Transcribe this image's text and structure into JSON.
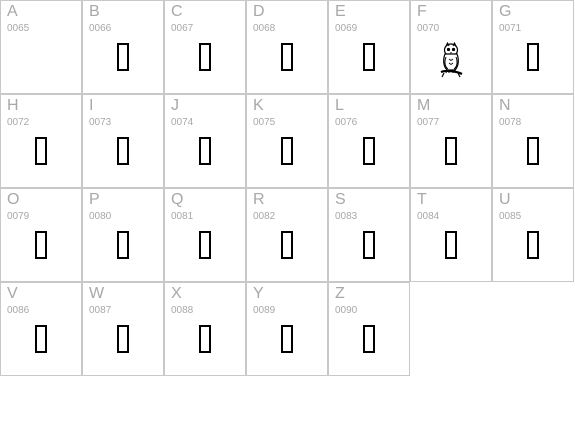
{
  "cells": [
    {
      "letter": "A",
      "code": "0065",
      "glyph": "empty"
    },
    {
      "letter": "B",
      "code": "0066",
      "glyph": "box"
    },
    {
      "letter": "C",
      "code": "0067",
      "glyph": "box"
    },
    {
      "letter": "D",
      "code": "0068",
      "glyph": "box"
    },
    {
      "letter": "E",
      "code": "0069",
      "glyph": "box"
    },
    {
      "letter": "F",
      "code": "0070",
      "glyph": "owl-icon"
    },
    {
      "letter": "G",
      "code": "0071",
      "glyph": "box"
    },
    {
      "letter": "H",
      "code": "0072",
      "glyph": "box"
    },
    {
      "letter": "I",
      "code": "0073",
      "glyph": "box"
    },
    {
      "letter": "J",
      "code": "0074",
      "glyph": "box"
    },
    {
      "letter": "K",
      "code": "0075",
      "glyph": "box"
    },
    {
      "letter": "L",
      "code": "0076",
      "glyph": "box"
    },
    {
      "letter": "M",
      "code": "0077",
      "glyph": "box"
    },
    {
      "letter": "N",
      "code": "0078",
      "glyph": "box"
    },
    {
      "letter": "O",
      "code": "0079",
      "glyph": "box"
    },
    {
      "letter": "P",
      "code": "0080",
      "glyph": "box"
    },
    {
      "letter": "Q",
      "code": "0081",
      "glyph": "box"
    },
    {
      "letter": "R",
      "code": "0082",
      "glyph": "box"
    },
    {
      "letter": "S",
      "code": "0083",
      "glyph": "box"
    },
    {
      "letter": "T",
      "code": "0084",
      "glyph": "box"
    },
    {
      "letter": "U",
      "code": "0085",
      "glyph": "box"
    },
    {
      "letter": "V",
      "code": "0086",
      "glyph": "box"
    },
    {
      "letter": "W",
      "code": "0087",
      "glyph": "box"
    },
    {
      "letter": "X",
      "code": "0088",
      "glyph": "box"
    },
    {
      "letter": "Y",
      "code": "0089",
      "glyph": "box"
    },
    {
      "letter": "Z",
      "code": "0090",
      "glyph": "box"
    }
  ],
  "colors": {
    "label": "#a8a8a8",
    "border": "#c8c8c8",
    "glyph": "#000000"
  }
}
